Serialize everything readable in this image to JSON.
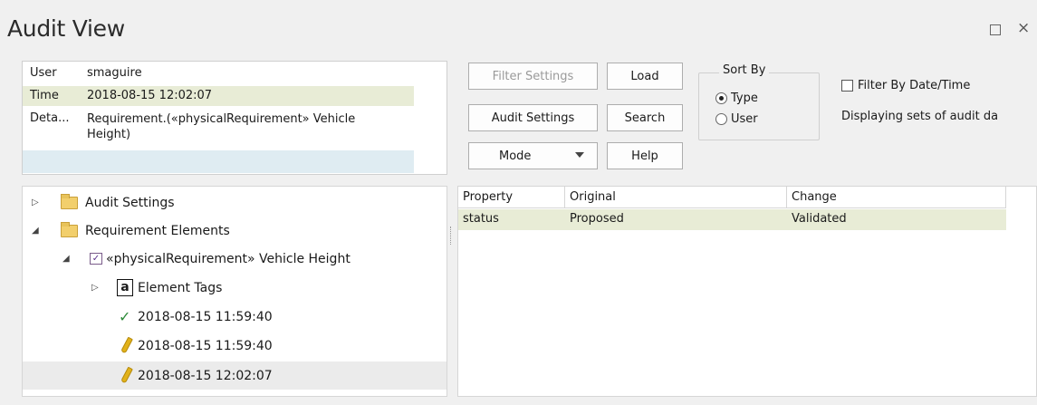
{
  "window": {
    "title": "Audit View",
    "maximize_glyph": "□",
    "close_glyph": "×"
  },
  "detail": {
    "user_key": "User",
    "user_value": "smaguire",
    "time_key": "Time",
    "time_value": "2018-08-15 12:02:07",
    "details_key": "Deta...",
    "details_value": "Requirement.(«physicalRequirement» Vehicle Height)"
  },
  "buttons": {
    "filter_settings": "Filter Settings",
    "load": "Load",
    "audit_settings": "Audit Settings",
    "search": "Search",
    "mode": "Mode",
    "help": "Help"
  },
  "sort_by": {
    "legend": "Sort By",
    "options": [
      "Type",
      "User"
    ],
    "selected": "Type"
  },
  "filter_by_date": {
    "label": "Filter By Date/Time",
    "checked": false
  },
  "status_text": "Displaying sets of audit da",
  "tree": {
    "items": [
      {
        "label": "Audit Settings",
        "icon": "folder-icon",
        "expander": "▷"
      },
      {
        "label": "Requirement Elements",
        "icon": "folder-icon",
        "expander": "◢"
      },
      {
        "label": "«physicalRequirement» Vehicle Height",
        "icon": "requirement-icon",
        "expander": "◢"
      },
      {
        "label": "Element Tags",
        "icon": "tag-icon",
        "icon_text": "a",
        "expander": "▷"
      },
      {
        "label": "2018-08-15 11:59:40",
        "icon": "checkmark-icon",
        "glyph": "✓"
      },
      {
        "label": "2018-08-15 11:59:40",
        "icon": "pencil-icon"
      },
      {
        "label": "2018-08-15 12:02:07",
        "icon": "pencil-icon"
      }
    ]
  },
  "grid": {
    "headers": [
      "Property",
      "Original",
      "Change"
    ],
    "rows": [
      {
        "property": "status",
        "original": "Proposed",
        "change": "Validated"
      }
    ]
  }
}
